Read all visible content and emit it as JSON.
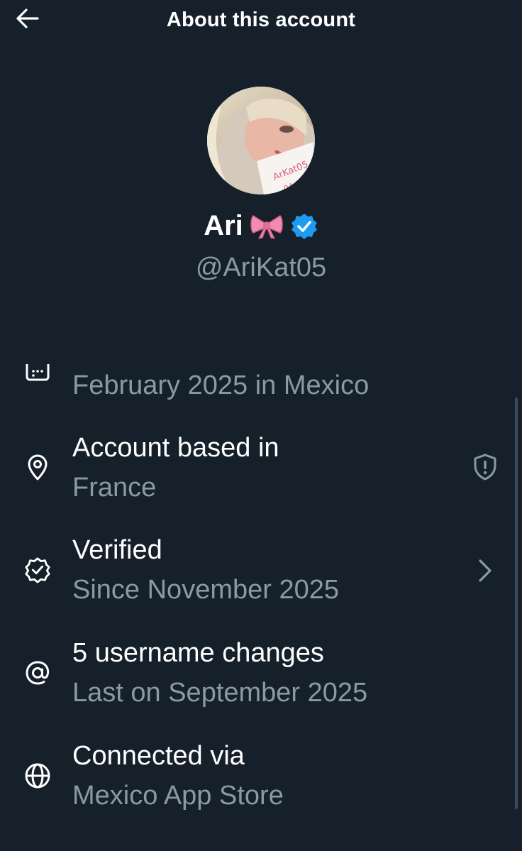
{
  "header": {
    "title": "About this account",
    "back_icon": "arrow-left-icon"
  },
  "profile": {
    "display_name": "Ari",
    "emoji": "bow-emoji",
    "verified_icon": "verified-badge-icon",
    "handle": "@AriKat05",
    "avatar_icon": "profile-photo"
  },
  "info_rows": [
    {
      "icon": "calendar-icon",
      "title": "",
      "subtitle": "February 2025 in Mexico"
    },
    {
      "icon": "location-pin-icon",
      "title": "Account based in",
      "subtitle": "France",
      "trailing_icon": "shield-alert-icon"
    },
    {
      "icon": "verified-outline-icon",
      "title": "Verified",
      "subtitle": "Since November 2025",
      "trailing_icon": "chevron-right-icon"
    },
    {
      "icon": "at-sign-icon",
      "title": "5 username changes",
      "subtitle": "Last on September 2025"
    },
    {
      "icon": "globe-icon",
      "title": "Connected via",
      "subtitle": "Mexico App Store"
    }
  ],
  "colors": {
    "background": "#15202b",
    "text_primary": "#ffffff",
    "text_secondary": "#8b98a5",
    "verified_blue": "#1d9bf0",
    "bow_pink": "#f08cb0"
  }
}
